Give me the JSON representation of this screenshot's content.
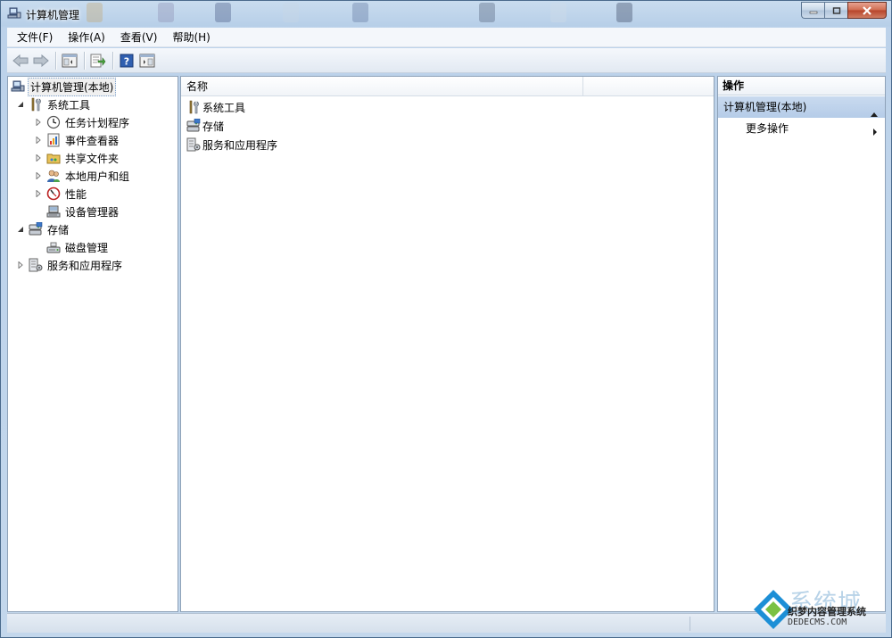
{
  "window": {
    "title": "计算机管理"
  },
  "menu": [
    "文件(F)",
    "操作(A)",
    "查看(V)",
    "帮助(H)"
  ],
  "toolbar": {
    "buttons": [
      "back",
      "forward",
      "show-hide-console-tree",
      "export-list",
      "help",
      "show-hide-action-pane"
    ]
  },
  "tree": {
    "root": "计算机管理(本地)",
    "system_tools": "系统工具",
    "task_scheduler": "任务计划程序",
    "event_viewer": "事件查看器",
    "shared_folders": "共享文件夹",
    "local_users": "本地用户和组",
    "performance": "性能",
    "device_manager": "设备管理器",
    "storage": "存储",
    "disk_management": "磁盘管理",
    "services_apps": "服务和应用程序"
  },
  "list": {
    "column_name": "名称",
    "items": [
      "系统工具",
      "存储",
      "服务和应用程序"
    ]
  },
  "actions": {
    "header": "操作",
    "group": "计算机管理(本地)",
    "more": "更多操作"
  },
  "watermark": {
    "logo": "系统城",
    "sub": "织梦内容管理系统",
    "url": "DEDECMS.COM"
  },
  "colors": {
    "accent": "#b5cce8",
    "title_bar": "#c9dcef",
    "close_button": "#cf6a4f"
  }
}
